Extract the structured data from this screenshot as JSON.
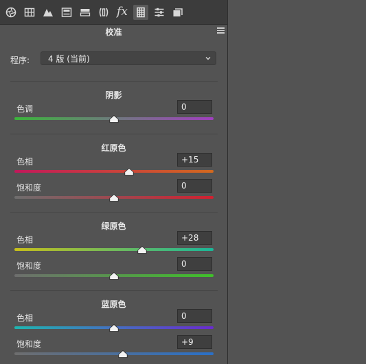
{
  "tabs": [
    {
      "name": "aperture-icon",
      "glyph": "❂"
    },
    {
      "name": "grid-icon",
      "glyph": "⊞"
    },
    {
      "name": "mountains-icon",
      "glyph": "▲"
    },
    {
      "name": "split-toning-icon",
      "glyph": "⊟"
    },
    {
      "name": "detail-bar-icon",
      "glyph": "⊏"
    },
    {
      "name": "lens-icon",
      "glyph": "(|)"
    },
    {
      "name": "fx-icon",
      "glyph": "fx"
    },
    {
      "name": "film-strip-icon",
      "glyph": "▦",
      "active": true
    },
    {
      "name": "sliders-icon",
      "glyph": "≋"
    },
    {
      "name": "snapshots-icon",
      "glyph": "❐"
    }
  ],
  "panel_title": "校准",
  "preset": {
    "label": "程序:",
    "value": "4 版 (当前)"
  },
  "sections": [
    {
      "title": "阴影",
      "sliders": [
        {
          "label": "色调",
          "value": "0",
          "position": 0.5,
          "gradient": [
            "#3bb53b",
            "#a13fc0"
          ]
        }
      ]
    },
    {
      "title": "红原色",
      "sliders": [
        {
          "label": "色相",
          "value": "+15",
          "position": 0.575,
          "gradient": [
            "#c2185b",
            "#d2691e"
          ]
        },
        {
          "label": "饱和度",
          "value": "0",
          "position": 0.5,
          "gradient": [
            "#6e6e6e",
            "#d22030"
          ]
        }
      ]
    },
    {
      "title": "绿原色",
      "sliders": [
        {
          "label": "色相",
          "value": "+28",
          "position": 0.64,
          "gradient": [
            "#c8c01a",
            "#1ab89a"
          ]
        },
        {
          "label": "饱和度",
          "value": "0",
          "position": 0.5,
          "gradient": [
            "#6e6e6e",
            "#3fc02a"
          ]
        }
      ]
    },
    {
      "title": "蓝原色",
      "sliders": [
        {
          "label": "色相",
          "value": "0",
          "position": 0.5,
          "gradient": [
            "#1fb5b0",
            "#6a2ad0"
          ]
        },
        {
          "label": "饱和度",
          "value": "+9",
          "position": 0.545,
          "gradient": [
            "#6e6e6e",
            "#2a70c8"
          ]
        }
      ]
    }
  ]
}
